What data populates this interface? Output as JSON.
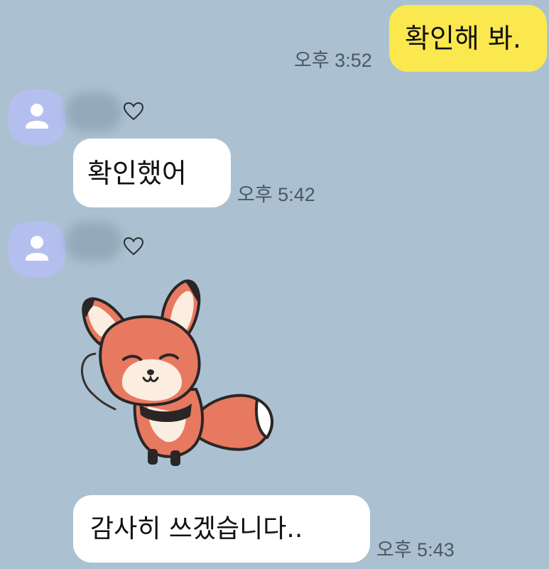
{
  "messages": [
    {
      "sender": "me",
      "text": "확인해 봐.",
      "time": "오후 3:52"
    },
    {
      "sender": "other",
      "text": "확인했어",
      "time": "오후 5:42"
    },
    {
      "sender": "other",
      "type": "sticker",
      "sticker": "fox-sticker"
    },
    {
      "sender": "other",
      "text": "감사히 쓰겠습니다..",
      "time": "오후 5:43"
    }
  ],
  "icons": {
    "avatar": "person-icon",
    "name_suffix": "heart-outline-icon"
  },
  "colors": {
    "background": "#abc1d1",
    "my_bubble": "#fbe84e",
    "their_bubble": "#ffffff",
    "avatar_bg": "#b4bff0"
  }
}
